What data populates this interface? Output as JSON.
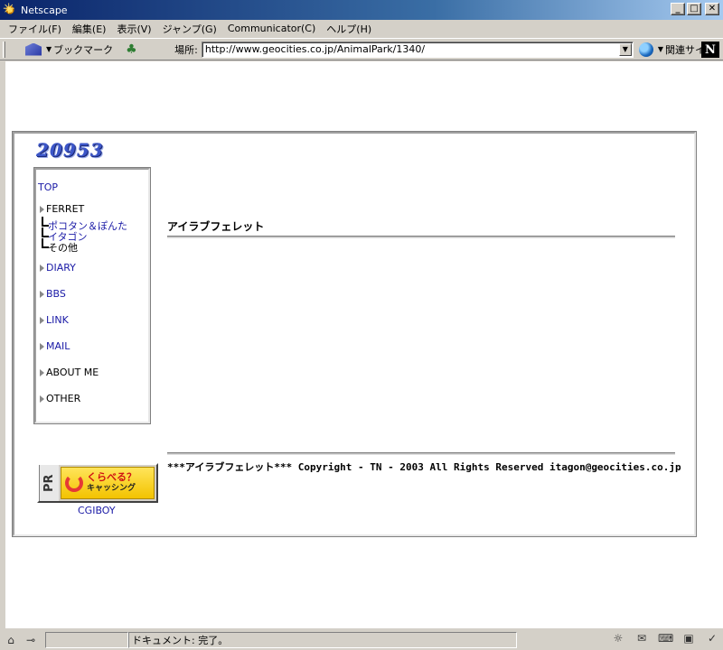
{
  "window": {
    "title": "Netscape"
  },
  "menubar": {
    "items": [
      "ファイル(F)",
      "編集(E)",
      "表示(V)",
      "ジャンプ(G)",
      "Communicator(C)",
      "ヘルプ(H)"
    ]
  },
  "toolbar": {
    "bookmark_label": "ブックマーク",
    "location_label": "場所:",
    "url": "http://www.geocities.co.jp/AnimalPark/1340/",
    "related_label": "関連サイト",
    "netscape_logo": "N"
  },
  "page": {
    "logo_text": "20953",
    "heading": "アイラブフェレット",
    "copyright": "***アイラブフェレット***  Copyright - TN - 2003  All Rights Reserved  itagon@geocities.co.jp",
    "nav": {
      "top": "TOP",
      "ferret": "FERRET",
      "sub1": "ポコタン＆ぽんた",
      "sub2": "イタゴン",
      "sub3": "その他",
      "diary": "DIARY",
      "bbs": "BBS",
      "link": "LINK",
      "mail": "MAIL",
      "about": "ABOUT ME",
      "other": "OTHER"
    },
    "banner": {
      "pr": "PR",
      "line1": "くらべる？",
      "line2": "キャッシング",
      "caption": "CGIBOY"
    }
  },
  "statusbar": {
    "text": "ドキュメント: 完了。"
  },
  "icons": {
    "app": "netscape-icon",
    "bookmark": "bookmark-icon",
    "globe": "globe-icon"
  }
}
